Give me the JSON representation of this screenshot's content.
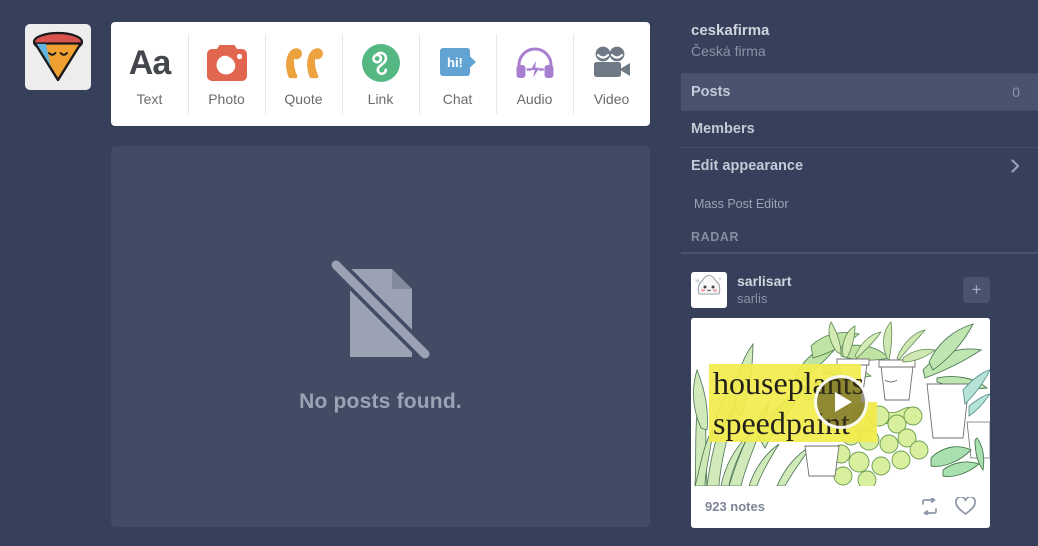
{
  "blog": {
    "avatar_icon": "cone-sleepy-face-logo",
    "name": "ceskafirma",
    "title": "Česká firma"
  },
  "post_types": [
    {
      "label": "Text",
      "icon": "text-aa-icon",
      "color": "#44464d"
    },
    {
      "label": "Photo",
      "icon": "camera-icon",
      "color": "#e0664f"
    },
    {
      "label": "Quote",
      "icon": "quote-marks-icon",
      "color": "#eda13f"
    },
    {
      "label": "Link",
      "icon": "link-chain-icon",
      "color": "#55b883"
    },
    {
      "label": "Chat",
      "icon": "chat-bubble-icon",
      "color": "#61a3d2"
    },
    {
      "label": "Audio",
      "icon": "headphones-icon",
      "color": "#a униq"
    },
    {
      "label": "Video",
      "icon": "movie-camera-icon",
      "color": "#707a86"
    }
  ],
  "posts_panel": {
    "empty_icon": "no-document-slash-icon",
    "empty_message": "No posts found."
  },
  "sidebar": {
    "nav": [
      {
        "label": "Posts",
        "count": "0",
        "selected": true,
        "chevron": false
      },
      {
        "label": "Members",
        "count": "",
        "selected": false,
        "chevron": false
      },
      {
        "label": "Edit appearance",
        "count": "",
        "selected": false,
        "chevron": true
      }
    ],
    "mass_post_editor": "Mass Post Editor",
    "radar_label": "RADAR"
  },
  "radar": {
    "avatar_icon": "sarlisart-avatar",
    "username": "sarlisart",
    "subtitle": "sarlis",
    "follow_label": "+",
    "post": {
      "thumb_icon": "houseplants-speedpaint-video-thumbnail",
      "overlay_line1": "houseplants",
      "overlay_line2": "speedpaint",
      "play_icon": "play-icon",
      "notes": "923 notes",
      "reblog_icon": "reblog-icon",
      "like_icon": "heart-icon"
    }
  },
  "colors": {
    "background": "#36405a",
    "panel": "#414c64",
    "selected_row": "#49536d",
    "white": "#ffffff",
    "highlight_yellow": "#f2ec4c"
  }
}
